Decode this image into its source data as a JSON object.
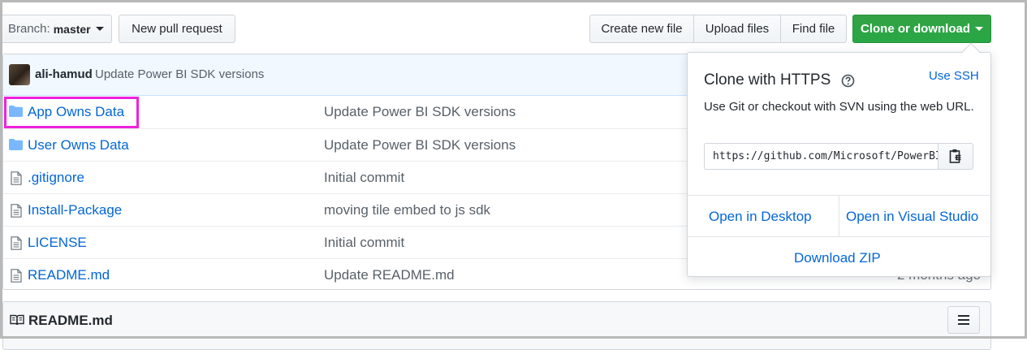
{
  "toolbar": {
    "branch_prefix": "Branch:",
    "branch_name": "master",
    "new_pull_request": "New pull request",
    "create_new_file": "Create new file",
    "upload_files": "Upload files",
    "find_file": "Find file",
    "clone_or_download": "Clone or download"
  },
  "commit": {
    "author": "ali-hamud",
    "message": "Update Power BI SDK versions"
  },
  "files": [
    {
      "type": "folder",
      "name": "App Owns Data",
      "message": "Update Power BI SDK versions",
      "age": ""
    },
    {
      "type": "folder",
      "name": "User Owns Data",
      "message": "Update Power BI SDK versions",
      "age": ""
    },
    {
      "type": "file",
      "name": ".gitignore",
      "message": "Initial commit",
      "age": ""
    },
    {
      "type": "file",
      "name": "Install-Package",
      "message": "moving tile embed to js sdk",
      "age": ""
    },
    {
      "type": "file",
      "name": "LICENSE",
      "message": "Initial commit",
      "age": ""
    },
    {
      "type": "file",
      "name": "README.md",
      "message": "Update README.md",
      "age": "2 months ago"
    }
  ],
  "readme": {
    "title": "README.md"
  },
  "clone_popover": {
    "title": "Clone with HTTPS",
    "use_ssh": "Use SSH",
    "description": "Use Git or checkout with SVN using the web URL.",
    "url": "https://github.com/Microsoft/PowerBI-Developer-Samples.git",
    "open_desktop": "Open in Desktop",
    "open_visual_studio": "Open in Visual Studio",
    "download_zip": "Download ZIP"
  },
  "colors": {
    "link": "#0366d6",
    "green_button": "#28a745",
    "highlight": "#ee22dd",
    "commit_bar": "#f1f8ff"
  }
}
